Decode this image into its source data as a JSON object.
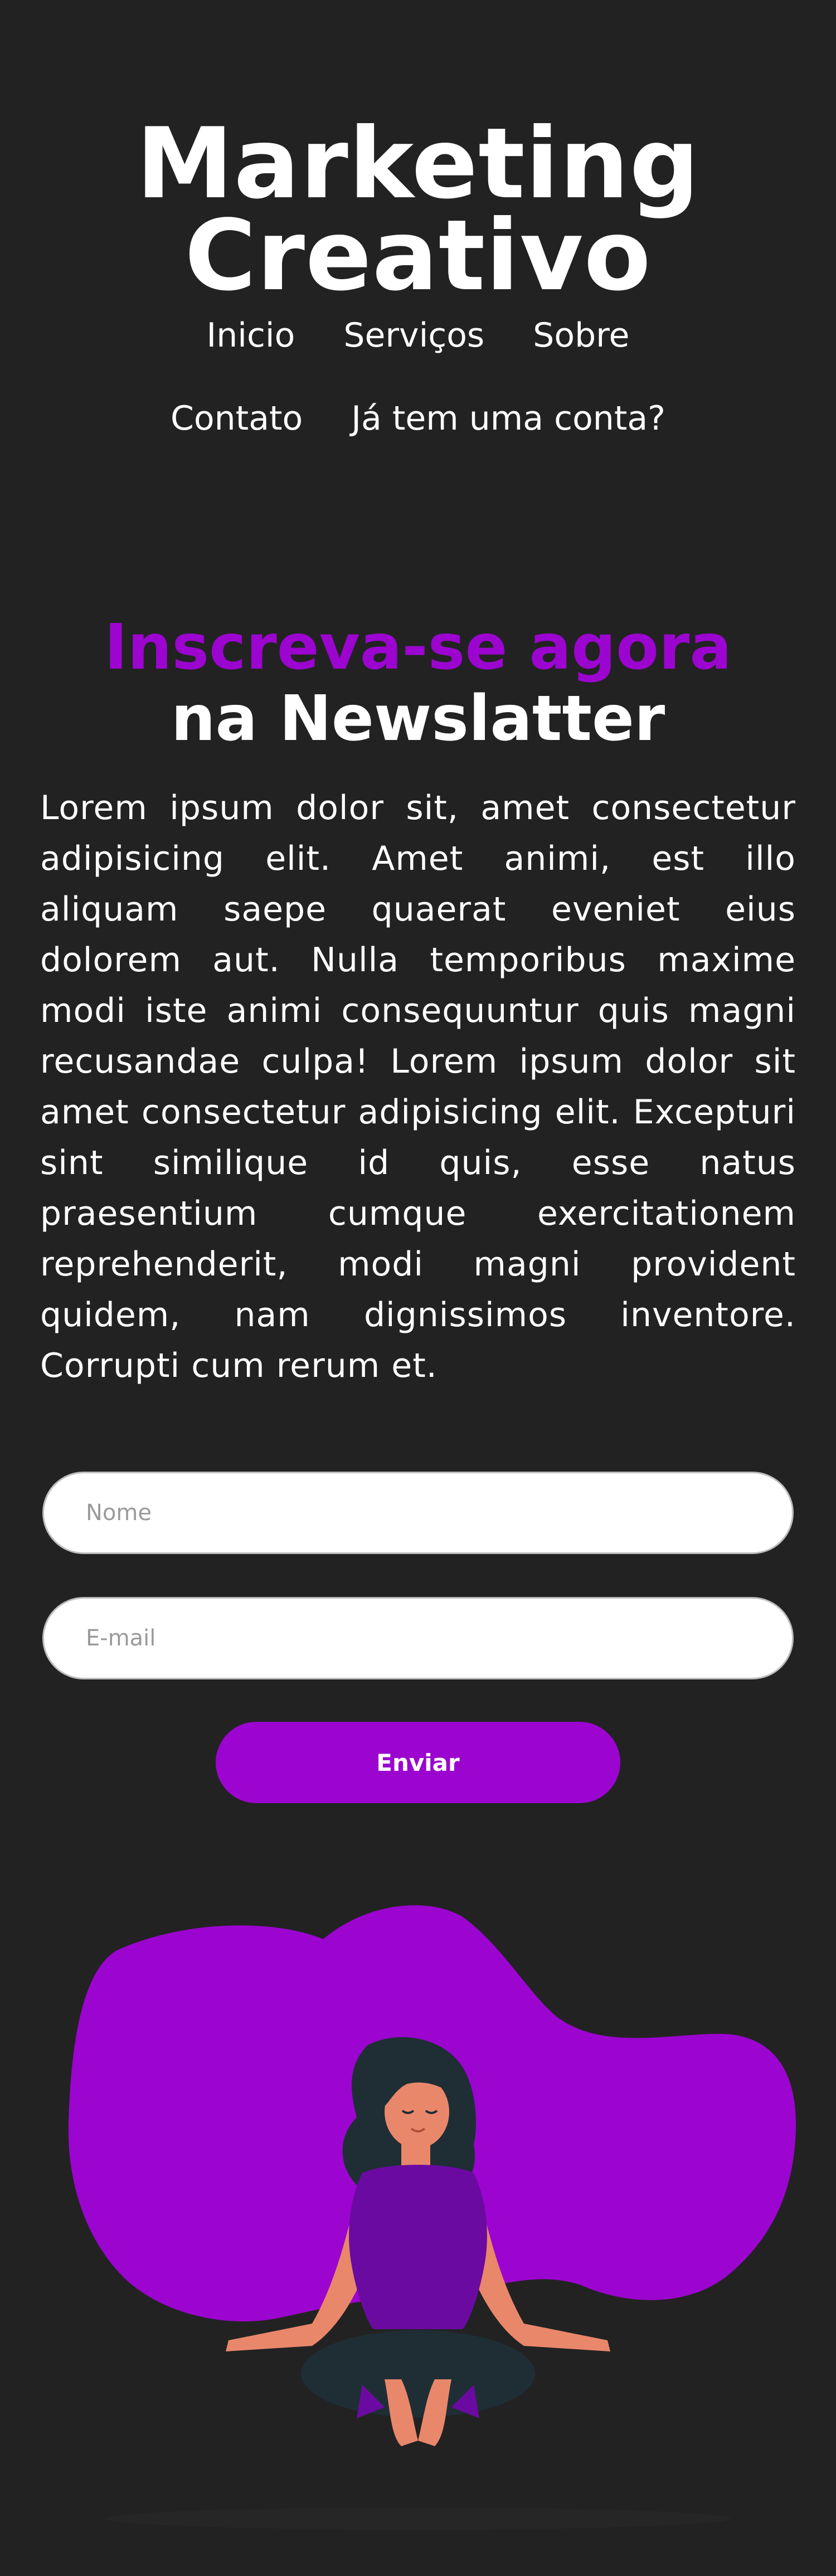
{
  "header": {
    "title_line_1": "Marketing",
    "title_line_2": "Creativo"
  },
  "nav": {
    "items": [
      {
        "label": "Inicio"
      },
      {
        "label": "Serviços"
      },
      {
        "label": "Sobre"
      },
      {
        "label": "Contato"
      },
      {
        "label": "Já tem uma conta?"
      }
    ]
  },
  "hero": {
    "headline_accent": "Inscreva-se agora",
    "headline_rest": "na Newslatter",
    "description": "Lorem ipsum dolor sit, amet consectetur adipisicing elit. Amet animi, est illo aliquam saepe quaerat eveniet eius dolorem aut. Nulla temporibus maxime modi iste animi consequuntur quis magni recusandae culpa! Lorem ipsum dolor sit amet consectetur adipisicing elit. Excepturi sint similique id quis, esse natus praesentium cumque exercitationem reprehenderit, modi magni provident quidem, nam dignissimos inventore. Corrupti cum rerum et."
  },
  "form": {
    "name_placeholder": "Nome",
    "email_placeholder": "E-mail",
    "submit_label": "Enviar"
  },
  "colors": {
    "background": "#222222",
    "accent": "#9b05cf",
    "text": "#ffffff",
    "skin": "#e9876b",
    "hair": "#1f2e35",
    "shirt": "#6b0aa1"
  },
  "illustration": {
    "icon": "meditating-woman-illustration"
  }
}
